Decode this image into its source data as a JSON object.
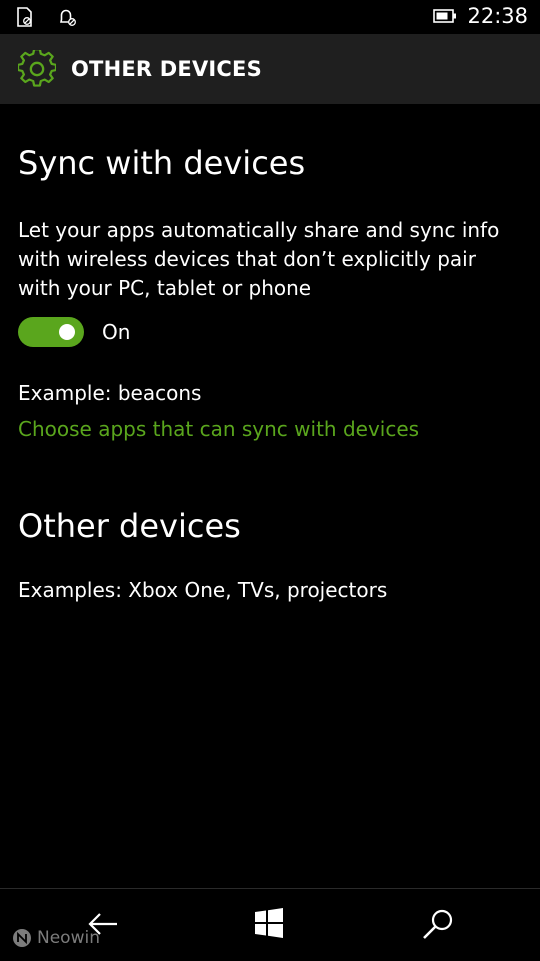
{
  "status_bar": {
    "left_icons": [
      "sim-card-blocked-icon",
      "notification-bell-blocked-icon"
    ],
    "battery_icon": "battery-icon",
    "time": "22:38"
  },
  "header": {
    "icon": "gear-icon",
    "title": "OTHER DEVICES"
  },
  "sync_section": {
    "heading": "Sync with devices",
    "description": "Let your apps automatically share and sync info with wireless devices that don’t explicitly pair with your PC, tablet or phone",
    "toggle": {
      "state": "on",
      "label": "On"
    },
    "example": "Example: beacons",
    "link": "Choose apps that can sync with devices"
  },
  "other_devices_section": {
    "heading": "Other devices",
    "examples": "Examples: Xbox One, TVs, projectors"
  },
  "nav_bar": {
    "back_icon": "back-arrow-icon",
    "start_icon": "windows-logo-icon",
    "search_icon": "search-icon"
  },
  "watermark": {
    "text": "Neowin"
  },
  "colors": {
    "accent": "#5aa61d",
    "background": "#000000",
    "header_bg": "#1f1f1f",
    "text": "#ffffff"
  }
}
